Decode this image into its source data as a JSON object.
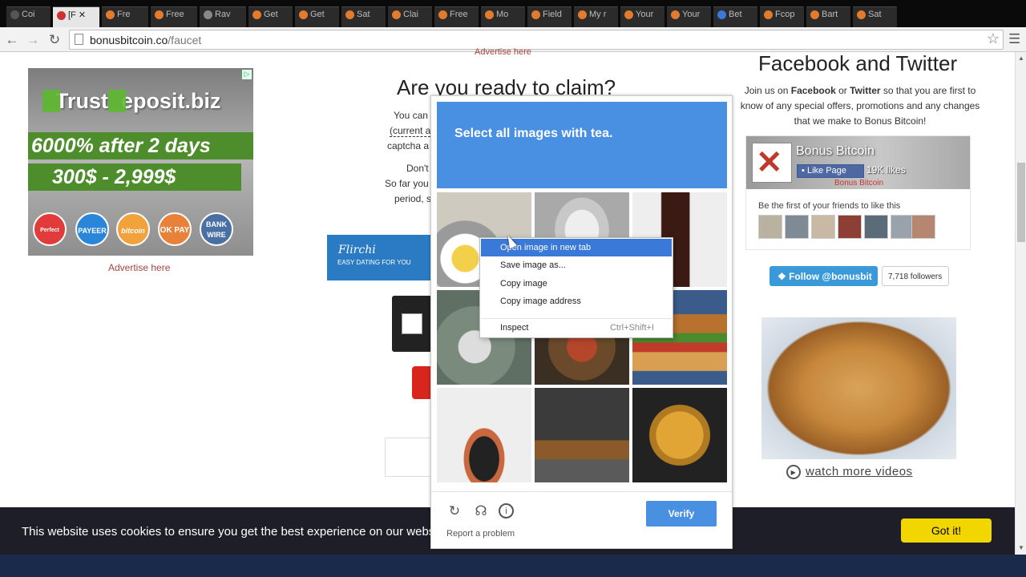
{
  "browser": {
    "tabs": [
      "Coi",
      "[F",
      "Fre",
      "Free",
      "Rav",
      "Get",
      "Get",
      "Sat",
      "Clai",
      "Free",
      "Mo",
      "Field",
      "My r",
      "Your",
      "Your",
      "Bet",
      "Fcop",
      "Bart",
      "Sat"
    ],
    "url_domain": "bonusbitcoin.co",
    "url_path": "/faucet"
  },
  "left_ad": {
    "title_prefix": "Trust",
    "title_suffix": "eposit.biz",
    "line1": "6000% after 2 days",
    "line2": "300$ - 2,999$",
    "coins": [
      "Perfect Money",
      "PAYEER",
      "bitcoin",
      "OK PAY",
      "BANK WIRE"
    ],
    "advertise": "Advertise here"
  },
  "center": {
    "advertise_top": "Advertise here",
    "title": "Are you ready to claim?",
    "text_line1": "You can",
    "text_line2": "(current a",
    "text_line3": "captcha a",
    "text_line4": "Don't",
    "text_line5": "So far you",
    "text_line6": "period, s",
    "flirchi_brand": "Flirchi",
    "flirchi_tag": "EASY DATING FOR YOU"
  },
  "right": {
    "heading": "Facebook and Twitter",
    "join_pre": "Join us on ",
    "facebook": "Facebook",
    "or": " or ",
    "twitter": "Twitter",
    "join_post": " so that you are first to",
    "line2": "know of any special offers, promotions and any changes",
    "line3": "that we make to Bonus Bitcoin!",
    "fb_name": "Bonus Bitcoin",
    "fb_like": "Like Page",
    "fb_likes": "19K likes",
    "fb_sub": "Bonus Bitcoin",
    "fb_friends_text": "Be the first of your friends to like this",
    "twitter_button": "Follow @bonusbit",
    "twitter_followers": "7,718 followers",
    "watch_more": "watch more videos"
  },
  "cookie": {
    "text": "This website uses cookies to ensure you get the best experience on our website",
    "button": "Got it!"
  },
  "captcha": {
    "prompt": "Select all images with tea.",
    "report": "Report a problem",
    "verify": "Verify"
  },
  "context_menu": {
    "items": [
      "Open image in new tab",
      "Save image as...",
      "Copy image",
      "Copy image address",
      "Inspect"
    ],
    "inspect_shortcut": "Ctrl+Shift+I"
  },
  "colors": {
    "captcha_blue": "#4a90e2",
    "cookie_button": "#f1d600",
    "twitter_blue": "#3a9ad9",
    "ad_green": "#4e8d2b"
  }
}
